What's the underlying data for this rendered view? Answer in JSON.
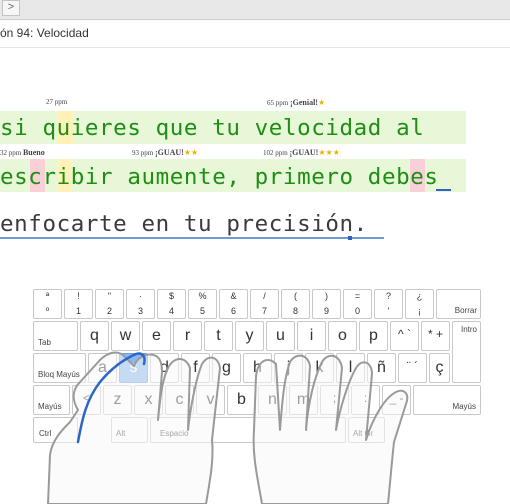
{
  "window": {
    "back_label": ">"
  },
  "lesson": {
    "title": "ón 94: Velocidad"
  },
  "speed_markers": [
    {
      "value": "27",
      "unit": "ppm",
      "label": "",
      "stars": ""
    },
    {
      "value": "65",
      "unit": "ppm",
      "label": "¡Genial!",
      "stars": "★"
    },
    {
      "value": "32",
      "unit": "ppm",
      "label": "Bueno",
      "stars": ""
    },
    {
      "value": "93",
      "unit": "ppm",
      "label": "¡GUAU!",
      "stars": "★★"
    },
    {
      "value": "102",
      "unit": "ppm",
      "label": "¡GUAU!",
      "stars": "★★★"
    }
  ],
  "text_lines": [
    "si quieres que tu velocidad al",
    "escribir aumente, primero debes",
    "enfocarte en tu precisión."
  ],
  "keyboard": {
    "active_key": "s",
    "row1": [
      {
        "top": "ª",
        "bottom": "º"
      },
      {
        "top": "!",
        "bottom": "1"
      },
      {
        "top": "\"",
        "bottom": "2"
      },
      {
        "top": "·",
        "bottom": "3"
      },
      {
        "top": "$",
        "bottom": "4"
      },
      {
        "top": "%",
        "bottom": "5"
      },
      {
        "top": "&",
        "bottom": "6"
      },
      {
        "top": "/",
        "bottom": "7"
      },
      {
        "top": "(",
        "bottom": "8"
      },
      {
        "top": ")",
        "bottom": "9"
      },
      {
        "top": "=",
        "bottom": "0"
      },
      {
        "top": "?",
        "bottom": "'"
      },
      {
        "top": "¿",
        "bottom": "¡"
      },
      {
        "top": "",
        "bottom": "Borrar"
      }
    ],
    "row2": [
      "Tab",
      "q",
      "w",
      "e",
      "r",
      "t",
      "y",
      "u",
      "i",
      "o",
      "p",
      "^ `",
      "* +",
      "Intro"
    ],
    "row3": [
      "Bloq Mayús",
      "a",
      "s",
      "d",
      "f",
      "g",
      "h",
      "j",
      "k",
      "l",
      "ñ",
      "¨ ´",
      "ç"
    ],
    "row4": [
      "Mayús",
      "<",
      "z",
      "x",
      "c",
      "v",
      "b",
      "n",
      "m",
      ";",
      ":",
      "_ -",
      "Mayús"
    ],
    "row5": [
      "Ctrl",
      "Alt",
      "Espacio",
      "Alt Gr"
    ]
  }
}
